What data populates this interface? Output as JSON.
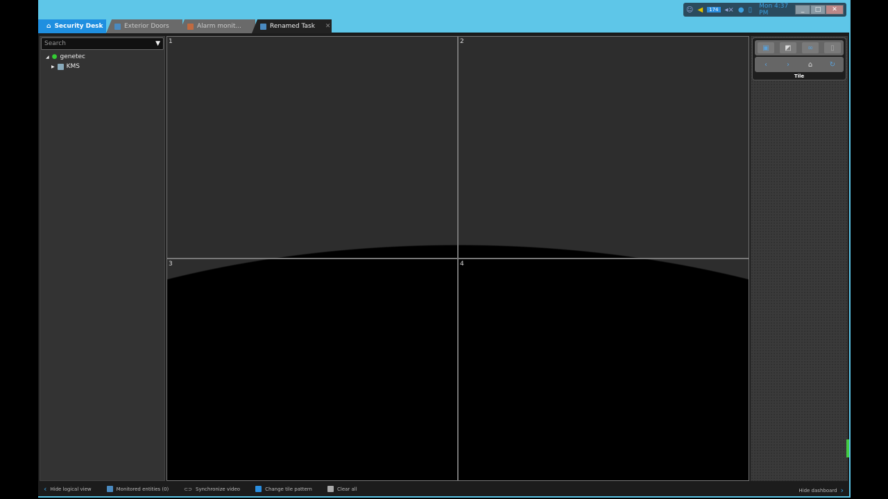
{
  "tray": {
    "badge": "174",
    "clock": "Mon 4:37 PM"
  },
  "tabs": [
    {
      "label": "Security Desk"
    },
    {
      "label": "Exterior Doors"
    },
    {
      "label": "Alarm monit..."
    },
    {
      "label": "Renamed Task"
    }
  ],
  "left": {
    "search_placeholder": "Search",
    "tree": [
      {
        "label": "genetec"
      },
      {
        "label": "KMS"
      }
    ]
  },
  "tiles": [
    "1",
    "2",
    "3",
    "4"
  ],
  "dashboard": {
    "label": "Tile"
  },
  "bottom": {
    "hide_logical": "Hide logical view",
    "monitored": "Monitored entities (0)",
    "sync": "Synchronize video",
    "pattern": "Change tile pattern",
    "clear": "Clear all",
    "hide_dash": "Hide dashboard"
  }
}
